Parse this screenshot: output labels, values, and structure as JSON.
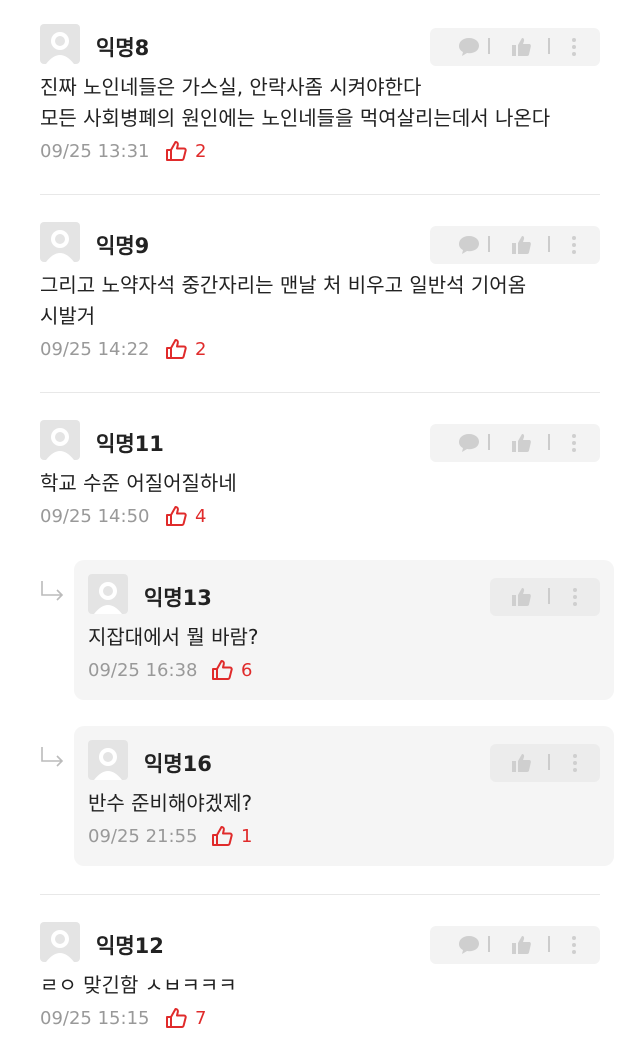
{
  "icons": {
    "avatar": "default-avatar-icon",
    "vote": "speech-bubble-icon",
    "like": "thumbs-up-icon",
    "more": "vertical-dots-icon",
    "reply": "reply-arrow-icon",
    "like_count": "thumbs-up-outline-icon"
  },
  "colors": {
    "like_count": "#e02b2b",
    "meta": "#999999",
    "reply_bg": "#f5f5f5",
    "action_bg": "#f3f3f3"
  },
  "comments": [
    {
      "nickname": "익명8",
      "lines": [
        "진짜 노인네들은 가스실, 안락사좀 시켜야한다",
        "모든 사회병폐의 원인에는 노인네들을 먹여살리는데서 나온다"
      ],
      "time": "09/25 13:31",
      "likes": "2"
    },
    {
      "nickname": "익명9",
      "lines": [
        "그리고 노약자석 중간자리는 맨날 처 비우고 일반석 기어옴",
        "시발거"
      ],
      "time": "09/25 14:22",
      "likes": "2"
    },
    {
      "nickname": "익명11",
      "lines": [
        "학교 수준 어질어질하네"
      ],
      "time": "09/25 14:50",
      "likes": "4"
    },
    {
      "nickname": "익명12",
      "lines": [
        "ㄹㅇ 맞긴함 ㅅㅂㅋㅋㅋ"
      ],
      "time": "09/25 15:15",
      "likes": "7"
    }
  ],
  "replies": [
    {
      "nickname": "익명13",
      "text": "지잡대에서 뭘 바람?",
      "time": "09/25 16:38",
      "likes": "6"
    },
    {
      "nickname": "익명16",
      "text": "반수 준비해야겠제?",
      "time": "09/25 21:55",
      "likes": "1"
    }
  ]
}
